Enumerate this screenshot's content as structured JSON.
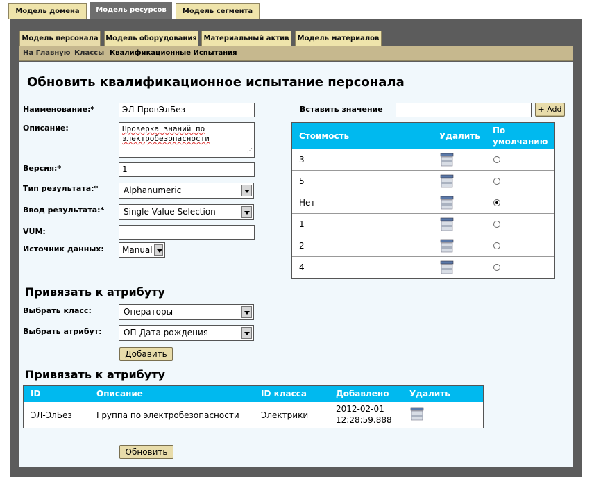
{
  "top_tabs": [
    {
      "label": "Модель домена",
      "active": false
    },
    {
      "label": "Модель ресурсов",
      "active": true
    },
    {
      "label": "Модель сегмента",
      "active": false
    }
  ],
  "inner_tabs": [
    {
      "label": "Модель персонала",
      "active": true
    },
    {
      "label": "Модель оборудования",
      "active": false
    },
    {
      "label": "Материальный актив",
      "active": false
    },
    {
      "label": "Модель материалов",
      "active": false
    }
  ],
  "breadcrumb": {
    "home": "На Главную",
    "classes": "Классы",
    "current": "Квалификационные Испытания"
  },
  "page_title": "Обновить квалификационное испытание персонала",
  "form": {
    "name_label": "Наименование:*",
    "name_value": "ЭЛ-ПровЭлБез",
    "desc_label": "Описание:",
    "desc_value": "Проверка знаний по электробезопасности",
    "version_label": "Версия:*",
    "version_value": "1",
    "result_type_label": "Тип результата:*",
    "result_type_value": "Alphanumeric",
    "result_input_label": "Ввод результата:*",
    "result_input_value": "Single Value Selection",
    "vum_label": "VUM:",
    "vum_value": "",
    "source_label": "Источник данных:",
    "source_value": "Manual"
  },
  "insert": {
    "label": "Вставить значение",
    "value": "",
    "add_button": "+ Add"
  },
  "values_table": {
    "headers": {
      "cost": "Стоимость",
      "delete": "Удалить",
      "default_line1": "По",
      "default_line2": "умолчанию"
    },
    "rows": [
      {
        "value": "3",
        "default": false
      },
      {
        "value": "5",
        "default": false
      },
      {
        "value": "Нет",
        "default": true
      },
      {
        "value": "1",
        "default": false
      },
      {
        "value": "2",
        "default": false
      },
      {
        "value": "4",
        "default": false
      }
    ]
  },
  "bind_section": {
    "title": "Привязать к атрибуту",
    "class_label": "Выбрать класс:",
    "class_value": "Операторы",
    "attr_label": "Выбрать атрибут:",
    "attr_value": "ОП-Дата рождения",
    "add_button": "Добавить"
  },
  "attr_section": {
    "title": "Привязать к атрибуту",
    "headers": {
      "id": "ID",
      "desc": "Описание",
      "class_id": "ID класса",
      "added": "Добавлено",
      "delete": "Удалить"
    },
    "rows": [
      {
        "id": "ЭЛ-ЭлБез",
        "desc": "Группа по электробезопасности",
        "class_id": "Электрики",
        "added_date": "2012-02-01",
        "added_time": "12:28:59.888"
      }
    ]
  },
  "update_button": "Обновить",
  "colors": {
    "header_blue": "#00b9ef",
    "tab_beige": "#efe4ab",
    "frame_gray": "#5c5c5c",
    "content_bg": "#f1f8fc"
  }
}
